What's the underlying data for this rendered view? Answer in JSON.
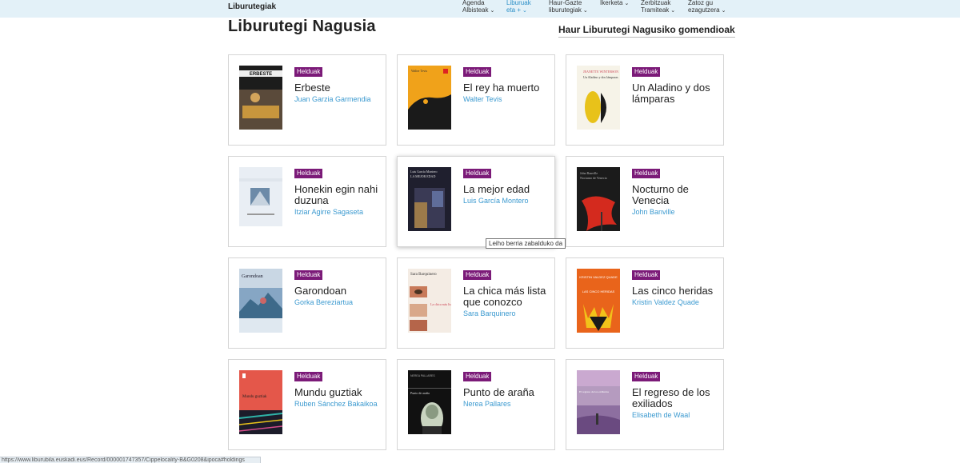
{
  "header": {
    "site_title": "Liburutegiak",
    "nav": [
      {
        "label": "Agenda\nAlbisteak",
        "active": false
      },
      {
        "label": "Liburuak\neta +",
        "active": true
      },
      {
        "label": "Haur-Gazte\nliburutegiak",
        "active": false
      },
      {
        "label": "Ikerketa",
        "active": false
      },
      {
        "label": "Zerbitzuak\nTramiteak",
        "active": false
      },
      {
        "label": "Zatoz gu\nezagutzera",
        "active": false
      }
    ]
  },
  "page": {
    "title": "Liburutegi Nagusia",
    "reco_link": "Haur Liburutegi Nagusiko gomendioak"
  },
  "books": [
    {
      "badge": "Helduak",
      "title": "Erbeste",
      "author": "Juan Garzia Garmendia",
      "cover_text": "ERBESTE",
      "cover_bg": "#1c1c1c",
      "cover_accent": "#c8963d"
    },
    {
      "badge": "Helduak",
      "title": "El rey ha muerto",
      "author": "Walter Tevis",
      "cover_text": "Walter Tevis",
      "cover_bg": "#f0a21a",
      "cover_accent": "#1a1a1a"
    },
    {
      "badge": "Helduak",
      "title": "Un Aladino y dos lámparas",
      "author": "",
      "cover_text": "Un Aladino y dos lámparas",
      "cover_bg": "#f6f3e8",
      "cover_accent": "#e8c21a"
    },
    {
      "badge": "Helduak",
      "title": "Honekin egin nahi duzuna",
      "author": "Itziar Agirre Sagaseta",
      "cover_text": "",
      "cover_bg": "#e9eef4",
      "cover_accent": "#6c8aa8"
    },
    {
      "badge": "Helduak",
      "title": "La mejor edad",
      "author": "Luis García Montero",
      "cover_text": "LA MEJOR EDAD",
      "cover_bg": "#1f1f2e",
      "cover_accent": "#9c7a4a"
    },
    {
      "badge": "Helduak",
      "title": "Nocturno de Venecia",
      "author": "John Banville",
      "cover_text": "Nocturno de Venecia",
      "cover_bg": "#1b1b1b",
      "cover_accent": "#d42a1e"
    },
    {
      "badge": "Helduak",
      "title": "Garondoan",
      "author": "Gorka Bereziartua",
      "cover_text": "Garondoan",
      "cover_bg": "#c9d7e4",
      "cover_accent": "#3e6a8a"
    },
    {
      "badge": "Helduak",
      "title": "La chica más lista que conozco",
      "author": "Sara Barquinero",
      "cover_text": "Sara Barquinero",
      "cover_bg": "#f4ece4",
      "cover_accent": "#c87a5a"
    },
    {
      "badge": "Helduak",
      "title": "Las cinco heridas",
      "author": "Kristin Valdez Quade",
      "cover_text": "LAS CINCO HERIDAS",
      "cover_bg": "#e9641b",
      "cover_accent": "#f2c21a"
    },
    {
      "badge": "Helduak",
      "title": "Mundu guztiak",
      "author": "Ruben Sánchez Bakaikoa",
      "cover_text": "Mundu guztiak",
      "cover_bg": "#e4574a",
      "cover_accent": "#2fb3a8"
    },
    {
      "badge": "Helduak",
      "title": "Punto de araña",
      "author": "Nerea Pallares",
      "cover_text": "Punto de araña",
      "cover_bg": "#111111",
      "cover_accent": "#c9d4c0"
    },
    {
      "badge": "Helduak",
      "title": "El regreso de los exiliados",
      "author": "Elisabeth de Waal",
      "cover_text": "El regreso de los exiliados",
      "cover_bg": "#b59bbf",
      "cover_accent": "#6a4a80"
    }
  ],
  "tooltip": "Leiho berria zabalduko da",
  "status_url": "https://www.liburubila.euskadi.eus/Record/000001747357/Cippelocality-B&G0208&ipoca#holdings"
}
